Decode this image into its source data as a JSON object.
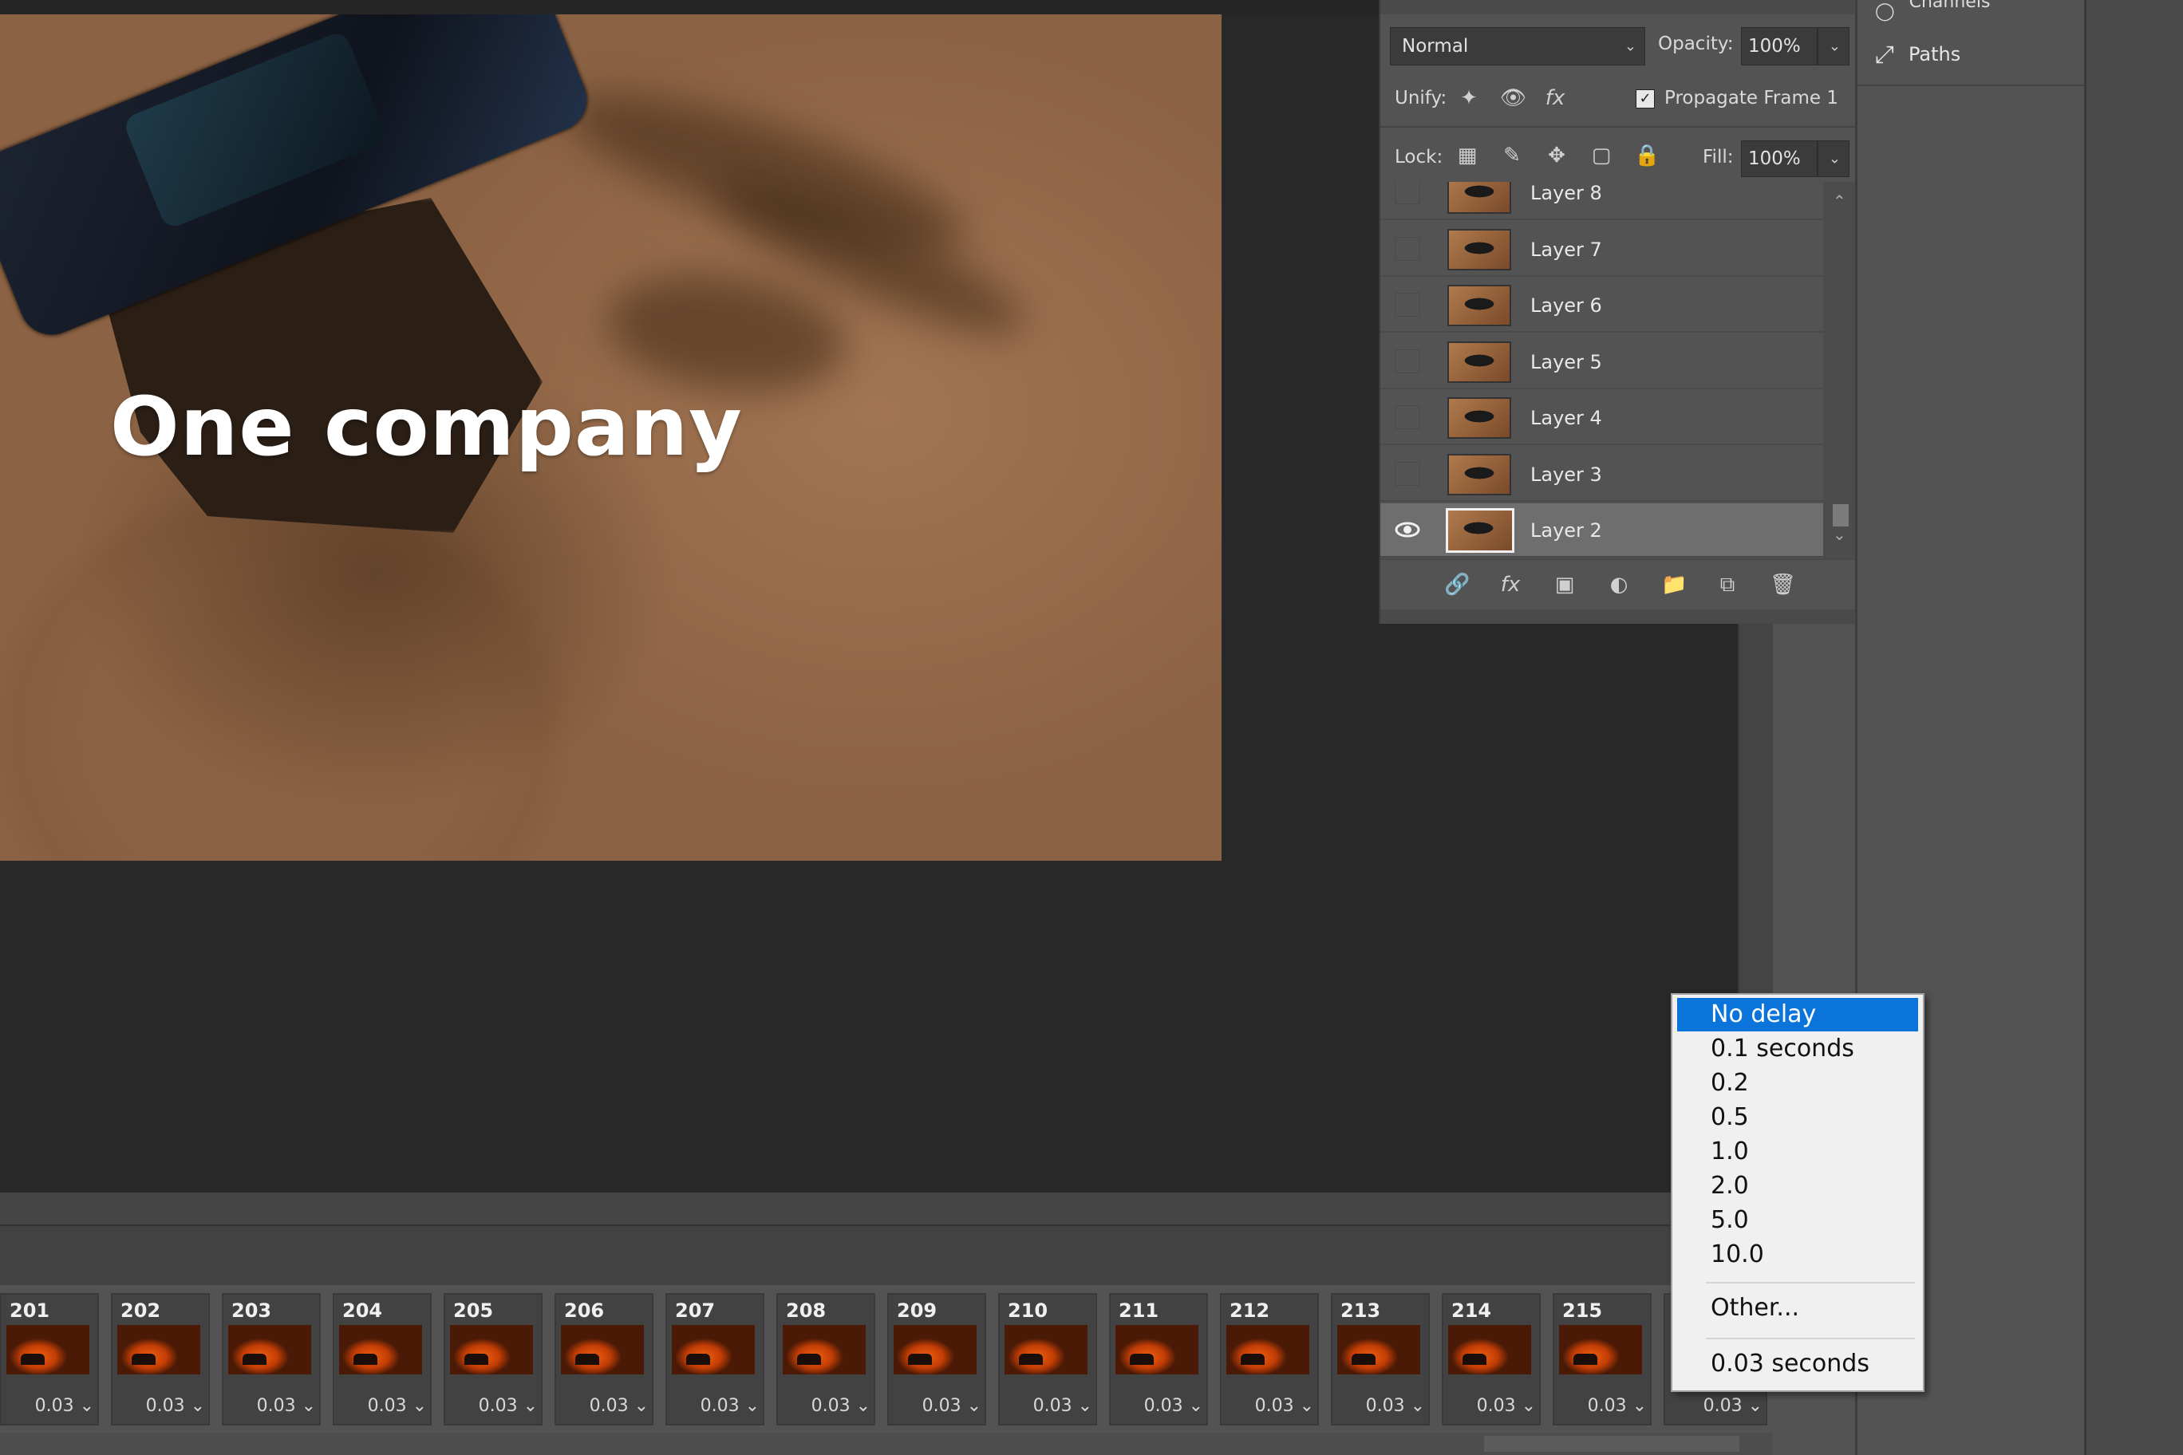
{
  "canvas": {
    "overlay_text": "One company"
  },
  "layers_panel": {
    "blend_mode": "Normal",
    "opacity_label": "Opacity:",
    "opacity_value": "100%",
    "unify_label": "Unify:",
    "propagate_label": "Propagate Frame 1",
    "propagate_checked": true,
    "lock_label": "Lock:",
    "fill_label": "Fill:",
    "fill_value": "100%",
    "layers": [
      {
        "name": "Layer 8",
        "visible": false,
        "selected": false
      },
      {
        "name": "Layer 7",
        "visible": false,
        "selected": false
      },
      {
        "name": "Layer 6",
        "visible": false,
        "selected": false
      },
      {
        "name": "Layer 5",
        "visible": false,
        "selected": false
      },
      {
        "name": "Layer 4",
        "visible": false,
        "selected": false
      },
      {
        "name": "Layer 3",
        "visible": false,
        "selected": false
      },
      {
        "name": "Layer 2",
        "visible": true,
        "selected": true
      }
    ]
  },
  "side_panel": {
    "channels_label": "Channels",
    "paths_label": "Paths"
  },
  "timeline": {
    "frames": [
      {
        "num": "201",
        "delay": "0.03"
      },
      {
        "num": "202",
        "delay": "0.03"
      },
      {
        "num": "203",
        "delay": "0.03"
      },
      {
        "num": "204",
        "delay": "0.03"
      },
      {
        "num": "205",
        "delay": "0.03"
      },
      {
        "num": "206",
        "delay": "0.03"
      },
      {
        "num": "207",
        "delay": "0.03"
      },
      {
        "num": "208",
        "delay": "0.03"
      },
      {
        "num": "209",
        "delay": "0.03"
      },
      {
        "num": "210",
        "delay": "0.03"
      },
      {
        "num": "211",
        "delay": "0.03"
      },
      {
        "num": "212",
        "delay": "0.03"
      },
      {
        "num": "213",
        "delay": "0.03"
      },
      {
        "num": "214",
        "delay": "0.03"
      },
      {
        "num": "215",
        "delay": "0.03"
      }
    ],
    "partial_frame_delay": "0.03"
  },
  "delay_menu": {
    "items": [
      "No delay",
      "0.1 seconds",
      "0.2",
      "0.5",
      "1.0",
      "2.0",
      "5.0",
      "10.0"
    ],
    "highlighted": "No delay",
    "other": "Other...",
    "current": "0.03 seconds"
  },
  "colors": {
    "menu_highlight": "#0a74da",
    "panel_bg": "#535353",
    "app_bg": "#282828"
  }
}
